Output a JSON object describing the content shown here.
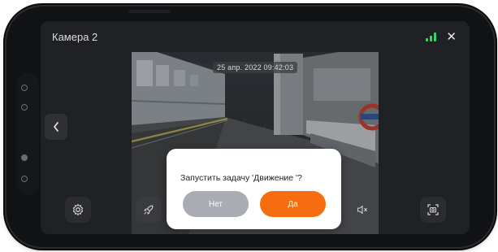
{
  "header": {
    "camera_title": "Камера 2"
  },
  "video": {
    "timestamp": "25 апр. 2022 09:42:03"
  },
  "dialog": {
    "message": "Запустить задачу 'Движение '?",
    "no_label": "Нет",
    "yes_label": "Да"
  },
  "icons": {
    "signal": "signal-bars-icon",
    "close": "close-icon",
    "back": "chevron-left-icon",
    "settings": "settings-gear-icon",
    "rocket": "rocket-icon",
    "mute": "speaker-mute-icon",
    "screenshot": "screenshot-icon"
  },
  "colors": {
    "accent": "#f56d0e",
    "secondary_button": "#a9acb2",
    "signal": "#3ecf6a"
  }
}
